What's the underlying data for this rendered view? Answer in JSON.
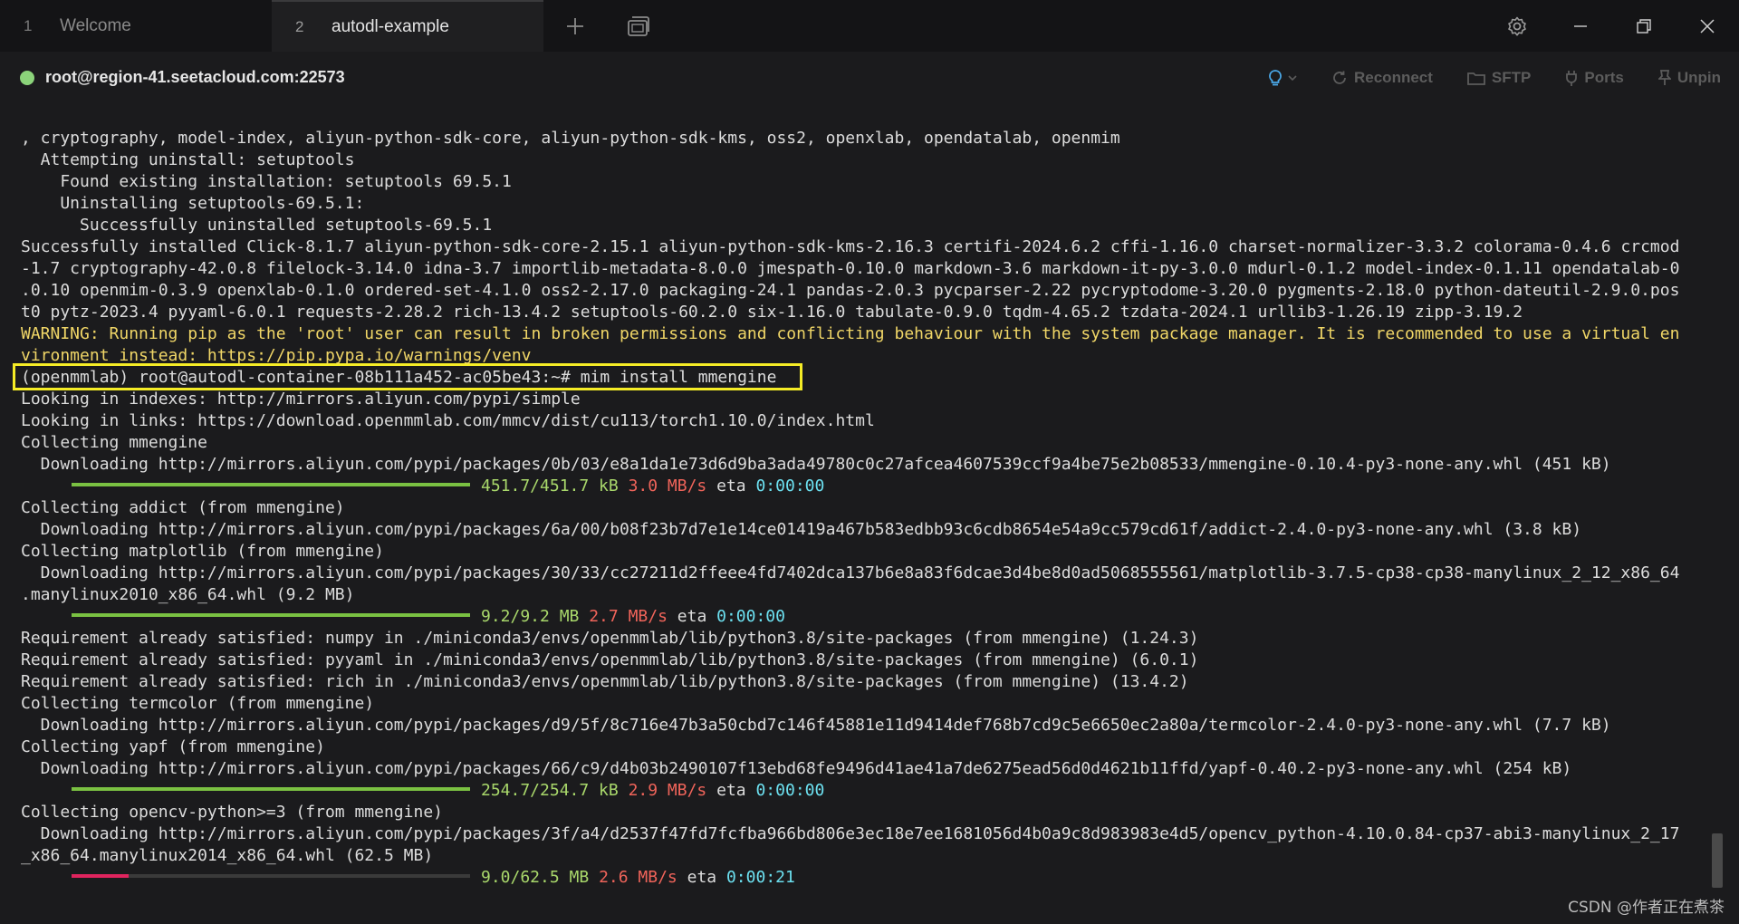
{
  "tabs": [
    {
      "num": "1",
      "label": "Welcome"
    },
    {
      "num": "2",
      "label": "autodl-example"
    }
  ],
  "session": {
    "host": "root@region-41.seetacloud.com:22573",
    "actions": [
      "Reconnect",
      "SFTP",
      "Ports",
      "Unpin"
    ]
  },
  "colors": {
    "status": "#8bd37a",
    "warning": "#f0d667",
    "progress": "#7ac142",
    "progress_partial": "#e0245e",
    "highlight": "#f5ec26"
  },
  "terminal": {
    "lines": [
      ", cryptography, model-index, aliyun-python-sdk-core, aliyun-python-sdk-kms, oss2, openxlab, opendatalab, openmim",
      "  Attempting uninstall: setuptools",
      "    Found existing installation: setuptools 69.5.1",
      "    Uninstalling setuptools-69.5.1:",
      "      Successfully uninstalled setuptools-69.5.1",
      "Successfully installed Click-8.1.7 aliyun-python-sdk-core-2.15.1 aliyun-python-sdk-kms-2.16.3 certifi-2024.6.2 cffi-1.16.0 charset-normalizer-3.3.2 colorama-0.4.6 crcmod",
      "-1.7 cryptography-42.0.8 filelock-3.14.0 idna-3.7 importlib-metadata-8.0.0 jmespath-0.10.0 markdown-3.6 markdown-it-py-3.0.0 mdurl-0.1.2 model-index-0.1.11 opendatalab-0",
      ".0.10 openmim-0.3.9 openxlab-0.1.0 ordered-set-4.1.0 oss2-2.17.0 packaging-24.1 pandas-2.0.3 pycparser-2.22 pycryptodome-3.20.0 pygments-2.18.0 python-dateutil-2.9.0.pos",
      "t0 pytz-2023.4 pyyaml-6.0.1 requests-2.28.2 rich-13.4.2 setuptools-60.2.0 six-1.16.0 tabulate-0.9.0 tqdm-4.65.2 tzdata-2024.1 urllib3-1.26.19 zipp-3.19.2",
      "WARNING: Running pip as the 'root' user can result in broken permissions and conflicting behaviour with the system package manager. It is recommended to use a virtual en",
      "vironment instead: https://pip.pypa.io/warnings/venv",
      "(openmmlab) root@autodl-container-08b111a452-ac05be43:~# mim install mmengine",
      "Looking in indexes: http://mirrors.aliyun.com/pypi/simple",
      "Looking in links: https://download.openmmlab.com/mmcv/dist/cu113/torch1.10.0/index.html",
      "Collecting mmengine",
      "  Downloading http://mirrors.aliyun.com/pypi/packages/0b/03/e8a1da1e73d6d9ba3ada49780c0c27afcea4607539ccf9a4be75e2b08533/mmengine-0.10.4-py3-none-any.whl (451 kB)",
      "",
      "Collecting addict (from mmengine)",
      "  Downloading http://mirrors.aliyun.com/pypi/packages/6a/00/b08f23b7d7e1e14ce01419a467b583edbb93c6cdb8654e54a9cc579cd61f/addict-2.4.0-py3-none-any.whl (3.8 kB)",
      "Collecting matplotlib (from mmengine)",
      "  Downloading http://mirrors.aliyun.com/pypi/packages/30/33/cc27211d2ffeee4fd7402dca137b6e8a83f6dcae3d4be8d0ad5068555561/matplotlib-3.7.5-cp38-cp38-manylinux_2_12_x86_64",
      ".manylinux2010_x86_64.whl (9.2 MB)",
      "",
      "Requirement already satisfied: numpy in ./miniconda3/envs/openmmlab/lib/python3.8/site-packages (from mmengine) (1.24.3)",
      "Requirement already satisfied: pyyaml in ./miniconda3/envs/openmmlab/lib/python3.8/site-packages (from mmengine) (6.0.1)",
      "Requirement already satisfied: rich in ./miniconda3/envs/openmmlab/lib/python3.8/site-packages (from mmengine) (13.4.2)",
      "Collecting termcolor (from mmengine)",
      "  Downloading http://mirrors.aliyun.com/pypi/packages/d9/5f/8c716e47b3a50cbd7c146f45881e11d9414def768b7cd9c5e6650ec2a80a/termcolor-2.4.0-py3-none-any.whl (7.7 kB)",
      "Collecting yapf (from mmengine)",
      "  Downloading http://mirrors.aliyun.com/pypi/packages/66/c9/d4b03b2490107f13ebd68fe9496d41ae41a7de6275ead56d0d4621b11ffd/yapf-0.40.2-py3-none-any.whl (254 kB)",
      "",
      "Collecting opencv-python>=3 (from mmengine)",
      "  Downloading http://mirrors.aliyun.com/pypi/packages/3f/a4/d2537f47fd7fcfba966bd806e3ec18e7ee1681056d4b0a9c8d983983e4d5/opencv_python-4.10.0.84-cp37-abi3-manylinux_2_17",
      "_x86_64.manylinux2014_x86_64.whl (62.5 MB)",
      ""
    ],
    "progress": [
      {
        "line": 16,
        "size": "451.7/451.7 kB",
        "speed": "3.0 MB/s",
        "eta_label": "eta",
        "eta": "0:00:00",
        "fraction": 1.0
      },
      {
        "line": 22,
        "size": "9.2/9.2 MB",
        "speed": "2.7 MB/s",
        "eta_label": "eta",
        "eta": "0:00:00",
        "fraction": 1.0
      },
      {
        "line": 30,
        "size": "254.7/254.7 kB",
        "speed": "2.9 MB/s",
        "eta_label": "eta",
        "eta": "0:00:00",
        "fraction": 1.0
      },
      {
        "line": 34,
        "size": "9.0/62.5 MB",
        "speed": "2.6 MB/s",
        "eta_label": "eta",
        "eta": "0:00:21",
        "fraction": 0.144
      }
    ]
  },
  "watermark": "CSDN @作者正在煮茶"
}
